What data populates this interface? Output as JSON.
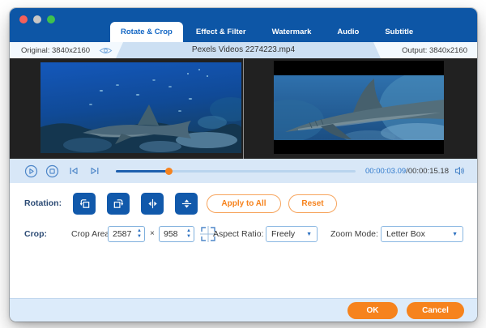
{
  "window": {
    "traffic_lights": [
      {
        "name": "close",
        "color": "#f4605a"
      },
      {
        "name": "minimize",
        "color": "#c9c7c5"
      },
      {
        "name": "zoom",
        "color": "#3ec14e"
      }
    ]
  },
  "tabs": [
    {
      "label": "Rotate & Crop",
      "active": true
    },
    {
      "label": "Effect & Filter",
      "active": false
    },
    {
      "label": "Watermark",
      "active": false
    },
    {
      "label": "Audio",
      "active": false
    },
    {
      "label": "Subtitle",
      "active": false
    }
  ],
  "header": {
    "original_label": "Original: 3840x2160",
    "eye_icon": "eye-preview-toggle",
    "filename": "Pexels Videos 2274223.mp4",
    "output_label": "Output: 3840x2160"
  },
  "playback": {
    "icons": [
      "play",
      "stop",
      "previous-frame",
      "next-frame"
    ],
    "progress_percent": 22,
    "time_current": "00:00:03.09",
    "time_separator": "/",
    "time_total": "00:00:15.18",
    "volume_icon": "speaker"
  },
  "rotation": {
    "label": "Rotation:",
    "buttons": [
      {
        "icon": "rotate-left"
      },
      {
        "icon": "rotate-right"
      },
      {
        "icon": "flip-horizontal"
      },
      {
        "icon": "flip-vertical"
      }
    ],
    "apply_to_all_label": "Apply to All",
    "reset_label": "Reset"
  },
  "crop": {
    "label": "Crop:",
    "area_label": "Crop Area:",
    "width_value": "2587",
    "multiply_sign": "×",
    "height_value": "958",
    "crosshair_icon": "crop-crosshair",
    "aspect_ratio_label": "Aspect Ratio:",
    "aspect_ratio_value": "Freely",
    "zoom_mode_label": "Zoom Mode:",
    "zoom_mode_value": "Letter Box"
  },
  "footer": {
    "ok_label": "OK",
    "cancel_label": "Cancel"
  },
  "colors": {
    "titlebar_blue": "#0d56a6",
    "accent_blue": "#1159ab",
    "accent_orange": "#f6831d",
    "header_strip": "#cde0f3",
    "playback_bar": "#d8e7f7",
    "footer_bar": "#dcebfa"
  }
}
